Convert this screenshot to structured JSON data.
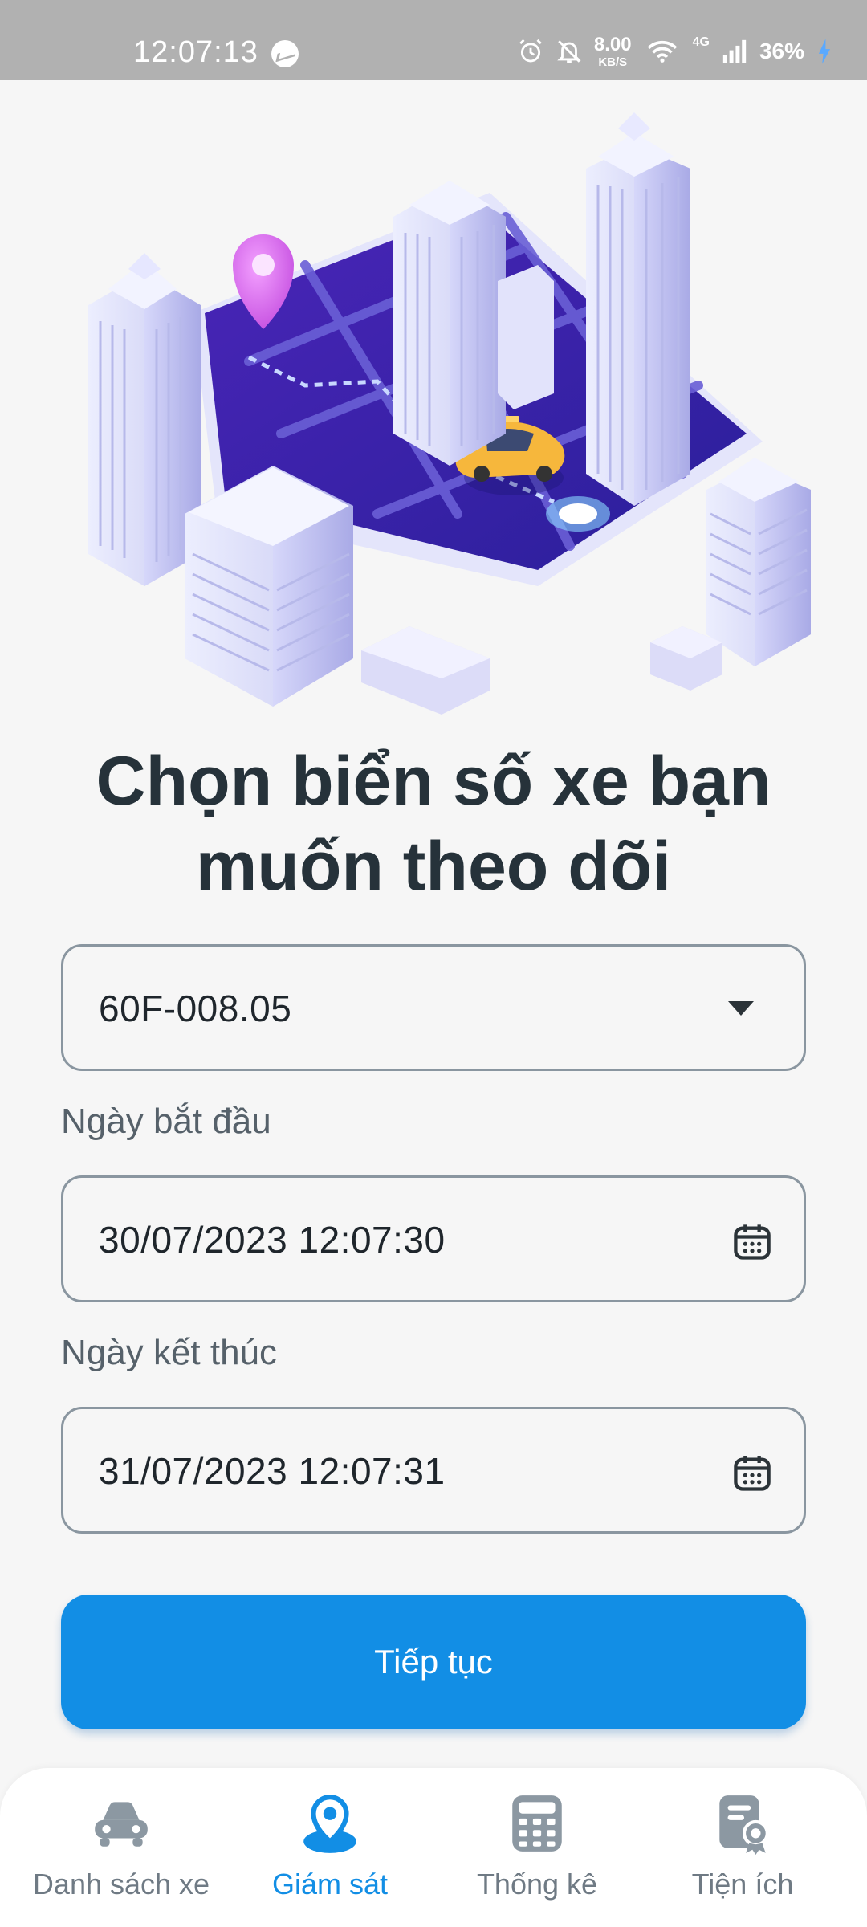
{
  "status_bar": {
    "time": "12:07:13",
    "speed_value": "8.00",
    "speed_unit": "KB/S",
    "network": "4G",
    "battery": "36%"
  },
  "page": {
    "title": "Chọn biển số xe bạn muốn theo dõi"
  },
  "form": {
    "vehicle_select": {
      "value": "60F-008.05",
      "icon": "chevron-down-icon"
    },
    "start_label": "Ngày bắt đầu",
    "start_value": "30/07/2023 12:07:30",
    "end_label": "Ngày kết thúc",
    "end_value": "31/07/2023 12:07:31",
    "submit_label": "Tiếp tục"
  },
  "nav": {
    "items": [
      {
        "label": "Danh sách xe",
        "icon": "car-icon",
        "active": false
      },
      {
        "label": "Giám sát",
        "icon": "location-pin-icon",
        "active": true
      },
      {
        "label": "Thống kê",
        "icon": "calculator-icon",
        "active": false
      },
      {
        "label": "Tiện ích",
        "icon": "certificate-icon",
        "active": false
      }
    ]
  },
  "colors": {
    "accent": "#128ee5",
    "status_bar": "#b1b1b1",
    "inactive_nav": "#6f7a84"
  }
}
